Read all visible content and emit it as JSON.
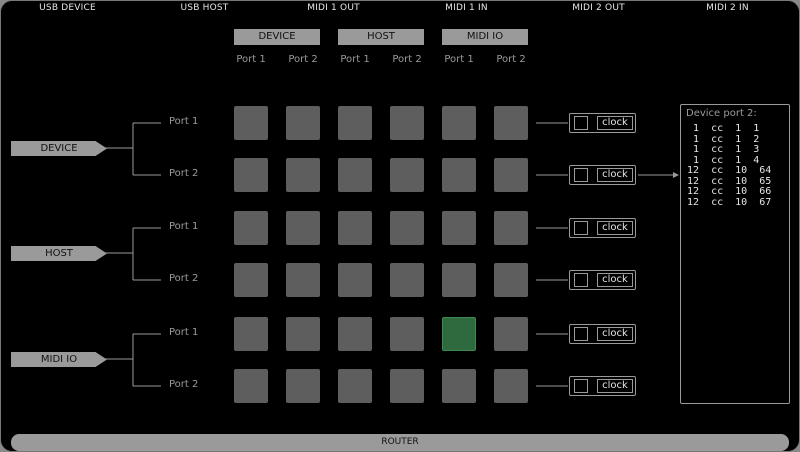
{
  "tabs": [
    "USB DEVICE",
    "USB HOST",
    "MIDI 1 OUT",
    "MIDI 1 IN",
    "MIDI 2 OUT",
    "MIDI 2 IN"
  ],
  "dest_groups": [
    "DEVICE",
    "HOST",
    "MIDI IO"
  ],
  "dest_ports": [
    "Port 1",
    "Port 2",
    "Port 1",
    "Port 2",
    "Port 1",
    "Port 2"
  ],
  "source_groups": [
    "DEVICE",
    "HOST",
    "MIDI IO"
  ],
  "source_ports": [
    "Port 1",
    "Port 2",
    "Port 1",
    "Port 2",
    "Port 1",
    "Port 2"
  ],
  "matrix": [
    [
      false,
      false,
      false,
      false,
      false,
      false
    ],
    [
      false,
      false,
      false,
      false,
      false,
      false
    ],
    [
      false,
      false,
      false,
      false,
      false,
      false
    ],
    [
      false,
      false,
      false,
      false,
      false,
      false
    ],
    [
      false,
      false,
      false,
      false,
      true,
      false
    ],
    [
      false,
      false,
      false,
      false,
      false,
      false
    ]
  ],
  "clock_label": "clock",
  "clock_checked": [
    false,
    false,
    false,
    false,
    false,
    false
  ],
  "monitor": {
    "title": "Device port 2:",
    "lines": [
      " 1  cc  1  1",
      " 1  cc  1  2",
      " 1  cc  1  3",
      " 1  cc  1  4",
      "12  cc  10  64",
      "12  cc  10  65",
      "12  cc  10  66",
      "12  cc  10  67"
    ]
  },
  "router_label": "ROUTER",
  "colors": {
    "active_cell": "#2e6a3e",
    "inactive_cell": "#5e5e5e",
    "accent_gray": "#9a9a9a"
  }
}
